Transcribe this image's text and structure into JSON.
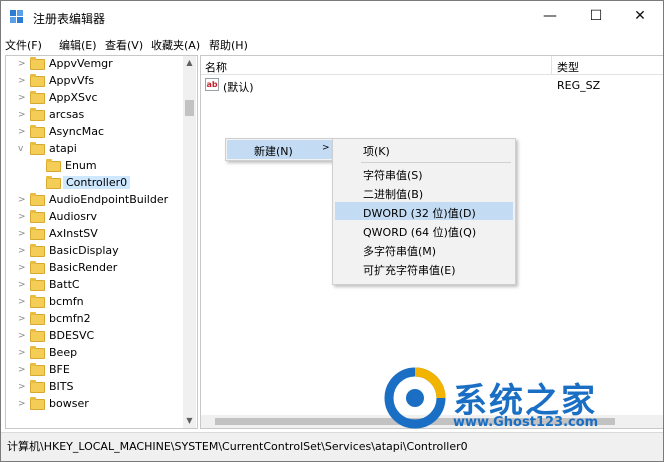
{
  "window": {
    "title": "注册表编辑器",
    "min_glyph": "—",
    "max_glyph": "☐",
    "close_glyph": "✕"
  },
  "menubar": [
    {
      "label": "文件(F)"
    },
    {
      "label": "编辑(E)"
    },
    {
      "label": "查看(V)"
    },
    {
      "label": "收藏夹(A)"
    },
    {
      "label": "帮助(H)"
    }
  ],
  "tree": {
    "items": [
      {
        "label": "AppvVemgr",
        "expander": ">"
      },
      {
        "label": "AppvVfs",
        "expander": ">"
      },
      {
        "label": "AppXSvc",
        "expander": ">"
      },
      {
        "label": "arcsas",
        "expander": ">"
      },
      {
        "label": "AsyncMac",
        "expander": ">"
      },
      {
        "label": "atapi",
        "expander": "v"
      },
      {
        "label": "Enum",
        "expander": ""
      },
      {
        "label": "Controller0",
        "expander": ""
      },
      {
        "label": "AudioEndpointBuilder",
        "expander": ">"
      },
      {
        "label": "Audiosrv",
        "expander": ">"
      },
      {
        "label": "AxInstSV",
        "expander": ">"
      },
      {
        "label": "BasicDisplay",
        "expander": ">"
      },
      {
        "label": "BasicRender",
        "expander": ">"
      },
      {
        "label": "BattC",
        "expander": ">"
      },
      {
        "label": "bcmfn",
        "expander": ">"
      },
      {
        "label": "bcmfn2",
        "expander": ">"
      },
      {
        "label": "BDESVC",
        "expander": ">"
      },
      {
        "label": "Beep",
        "expander": ">"
      },
      {
        "label": "BFE",
        "expander": ">"
      },
      {
        "label": "BITS",
        "expander": ">"
      },
      {
        "label": "bowser",
        "expander": ">"
      }
    ],
    "selected": "Controller0"
  },
  "values": {
    "col_name": "名称",
    "col_type": "类型",
    "rows": [
      {
        "icon": "ab",
        "name": "(默认)",
        "type": "REG_SZ"
      }
    ]
  },
  "context_menu": {
    "new_label": "新建(N)",
    "arrow": ">",
    "submenu": [
      {
        "label": "项(K)"
      },
      {
        "label": "字符串值(S)"
      },
      {
        "label": "二进制值(B)"
      },
      {
        "label": "DWORD (32 位)值(D)"
      },
      {
        "label": "QWORD (64 位)值(Q)"
      },
      {
        "label": "多字符串值(M)"
      },
      {
        "label": "可扩充字符串值(E)"
      }
    ],
    "highlighted": "DWORD (32 位)值(D)"
  },
  "statusbar": {
    "path": "计算机\\HKEY_LOCAL_MACHINE\\SYSTEM\\CurrentControlSet\\Services\\atapi\\Controller0"
  },
  "watermark": {
    "brand": "系统之家",
    "url": "www.Ghost123.com"
  },
  "colors": {
    "accent": "#1a6fc4",
    "highlight": "#c4dcf3",
    "selected": "#cde8ff"
  }
}
